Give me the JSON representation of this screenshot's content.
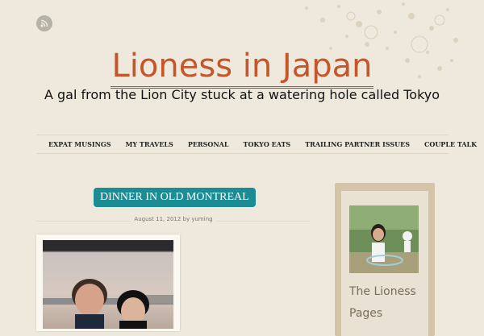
{
  "header": {
    "site_title": "Lioness in Japan",
    "tagline": "A gal from the Lion City stuck at a watering hole called Tokyo",
    "rss_icon": "rss-icon"
  },
  "nav": {
    "items": [
      "EXPAT MUSINGS",
      "MY TRAVELS",
      "PERSONAL",
      "TOKYO EATS",
      "TRAILING PARTNER ISSUES",
      "COUPLE TALK"
    ]
  },
  "post": {
    "title": "DINNER IN OLD MONTREAL",
    "meta": "August 11, 2012 by yuming"
  },
  "sidebar": {
    "widget_title": "The Lioness Pages"
  },
  "colors": {
    "background": "#efe9dd",
    "title": "#c4562a",
    "post_title_bg": "#1b8b94",
    "sidebar_frame": "#d5c5a8"
  }
}
